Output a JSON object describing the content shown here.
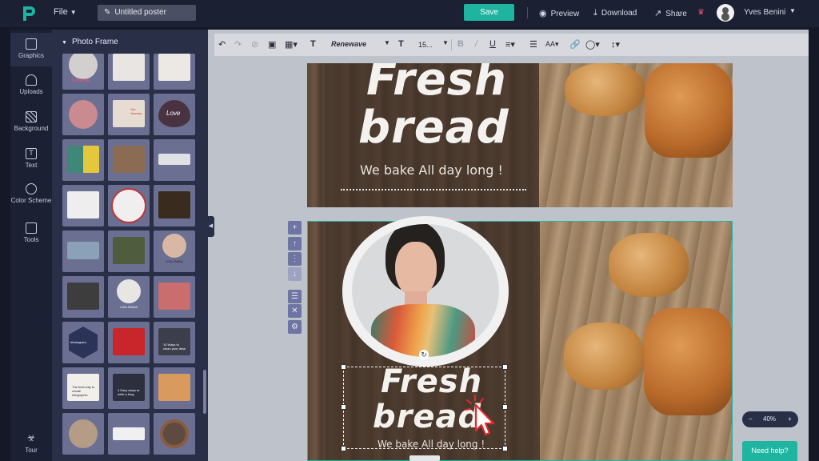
{
  "topbar": {
    "file_label": "File",
    "title_value": "Untitled poster",
    "save_label": "Save",
    "preview_label": "Preview",
    "download_label": "Download",
    "share_label": "Share",
    "username": "Yves Benini"
  },
  "rail": {
    "items": [
      {
        "label": "Graphics",
        "icon": "image-icon"
      },
      {
        "label": "Uploads",
        "icon": "cloud-upload-icon"
      },
      {
        "label": "Background",
        "icon": "hatch-icon"
      },
      {
        "label": "Text",
        "icon": "text-icon"
      },
      {
        "label": "Color Scheme",
        "icon": "palette-icon"
      },
      {
        "label": "Tools",
        "icon": "toolbox-icon"
      }
    ],
    "tour_label": "Tour"
  },
  "panel": {
    "title": "Photo Frame",
    "thumb_texts": {
      "love_me": "LOVE ME",
      "journey": "Our Journey",
      "love": "Love",
      "lisa": "LISA ISANA",
      "lisa2": "LISA ISANA",
      "instagram": "#instagram",
      "ways": "10 Ways to clean your desk",
      "steps": "4 Easy steps to write a blog",
      "best": "The best way to create infographic"
    }
  },
  "toolbar": {
    "font_name": "Renewave",
    "font_size": "15..."
  },
  "canvas": {
    "top_headline_1": "Fresh",
    "top_headline_2": "bread",
    "top_tagline": "We bake All day long !",
    "bottom_headline_1": "Fresh",
    "bottom_headline_2": "bread",
    "bottom_tagline": "We bake All day long !"
  },
  "zoom": {
    "minus": "−",
    "level": "40%",
    "plus": "+"
  },
  "help": {
    "label": "Need help?"
  },
  "colors": {
    "accent": "#1fb4a0",
    "topbar": "#1b2033",
    "panel": "#2a2f48",
    "workspace": "#bdc2cb"
  }
}
